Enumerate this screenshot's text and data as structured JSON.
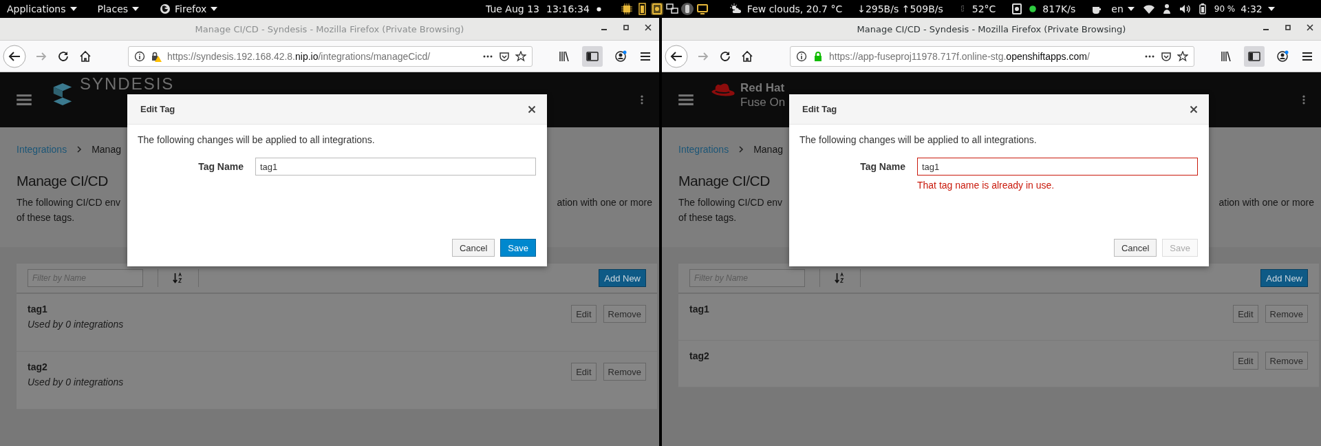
{
  "top_bar": {
    "menus": [
      {
        "label": "Applications",
        "kind": "menu"
      },
      {
        "label": "Places",
        "kind": "menu"
      },
      {
        "label": "Firefox",
        "kind": "app"
      }
    ],
    "date": "Tue Aug 13",
    "time": "13:16:34",
    "weather": "Few clouds, 20.7 °C",
    "net_speed": "↓295B/s ↑509B/s",
    "temperature": "52°C",
    "disk_speed": "817K/s",
    "language": "en",
    "battery": "90 %",
    "battery_time": "4:32"
  },
  "windows": [
    {
      "title": "Manage CI/CD - Syndesis - Mozilla Firefox (Private Browsing)",
      "active": false,
      "secure": false,
      "url": {
        "start": "https://syndesis.192.168.42.8.",
        "domain": "nip.io",
        "end": "/integrations/manageCicd/"
      },
      "brand": {
        "kind": "syndesis",
        "lines": [
          "SYNDESIS"
        ]
      },
      "breadcrumb": [
        "Integrations",
        "Manag"
      ],
      "heading": "Manage CI/CD",
      "description": {
        "start": "The following CI/CD env",
        "end": "ation with one or more",
        "line_2": "of these tags."
      },
      "filter": {
        "placeholder": "Filter by Name"
      },
      "add_button": "Add New",
      "tags": [
        {
          "name": "tag1",
          "usage": "Used by 0 integrations",
          "edit": "Edit",
          "remove": "Remove"
        },
        {
          "name": "tag2",
          "usage": "Used by 0 integrations",
          "edit": "Edit",
          "remove": "Remove"
        }
      ],
      "dialog": {
        "title": "Edit Tag",
        "intro": "The following changes will be applied to all integrations.",
        "field_label": "Tag Name",
        "value": "tag1",
        "invalid": false,
        "cancel": "Cancel",
        "save": "Save",
        "save_disabled": false
      }
    },
    {
      "title": "Manage CI/CD - Syndesis - Mozilla Firefox (Private Browsing)",
      "active": true,
      "secure": true,
      "url": {
        "start": "https://app-fuseproj11978.717f.online-stg.",
        "domain": "openshiftapps.com",
        "end": "/"
      },
      "brand": {
        "kind": "redhat",
        "lines": [
          "Red Hat",
          "Fuse On"
        ]
      },
      "breadcrumb": [
        "Integrations",
        "Manag"
      ],
      "heading": "Manage CI/CD",
      "description": {
        "start": "The following CI/CD env",
        "end": "ation with one or more",
        "line_2": "of these tags."
      },
      "filter": {
        "placeholder": "Filter by Name"
      },
      "add_button": "Add New",
      "tags": [
        {
          "name": "tag1",
          "edit": "Edit",
          "remove": "Remove"
        },
        {
          "name": "tag2",
          "edit": "Edit",
          "remove": "Remove"
        }
      ],
      "dialog": {
        "title": "Edit Tag",
        "intro": "The following changes will be applied to all integrations.",
        "field_label": "Tag Name",
        "value": "tag1",
        "invalid": true,
        "error": "That tag name is already in use.",
        "cancel": "Cancel",
        "save": "Save",
        "save_disabled": true
      }
    }
  ]
}
